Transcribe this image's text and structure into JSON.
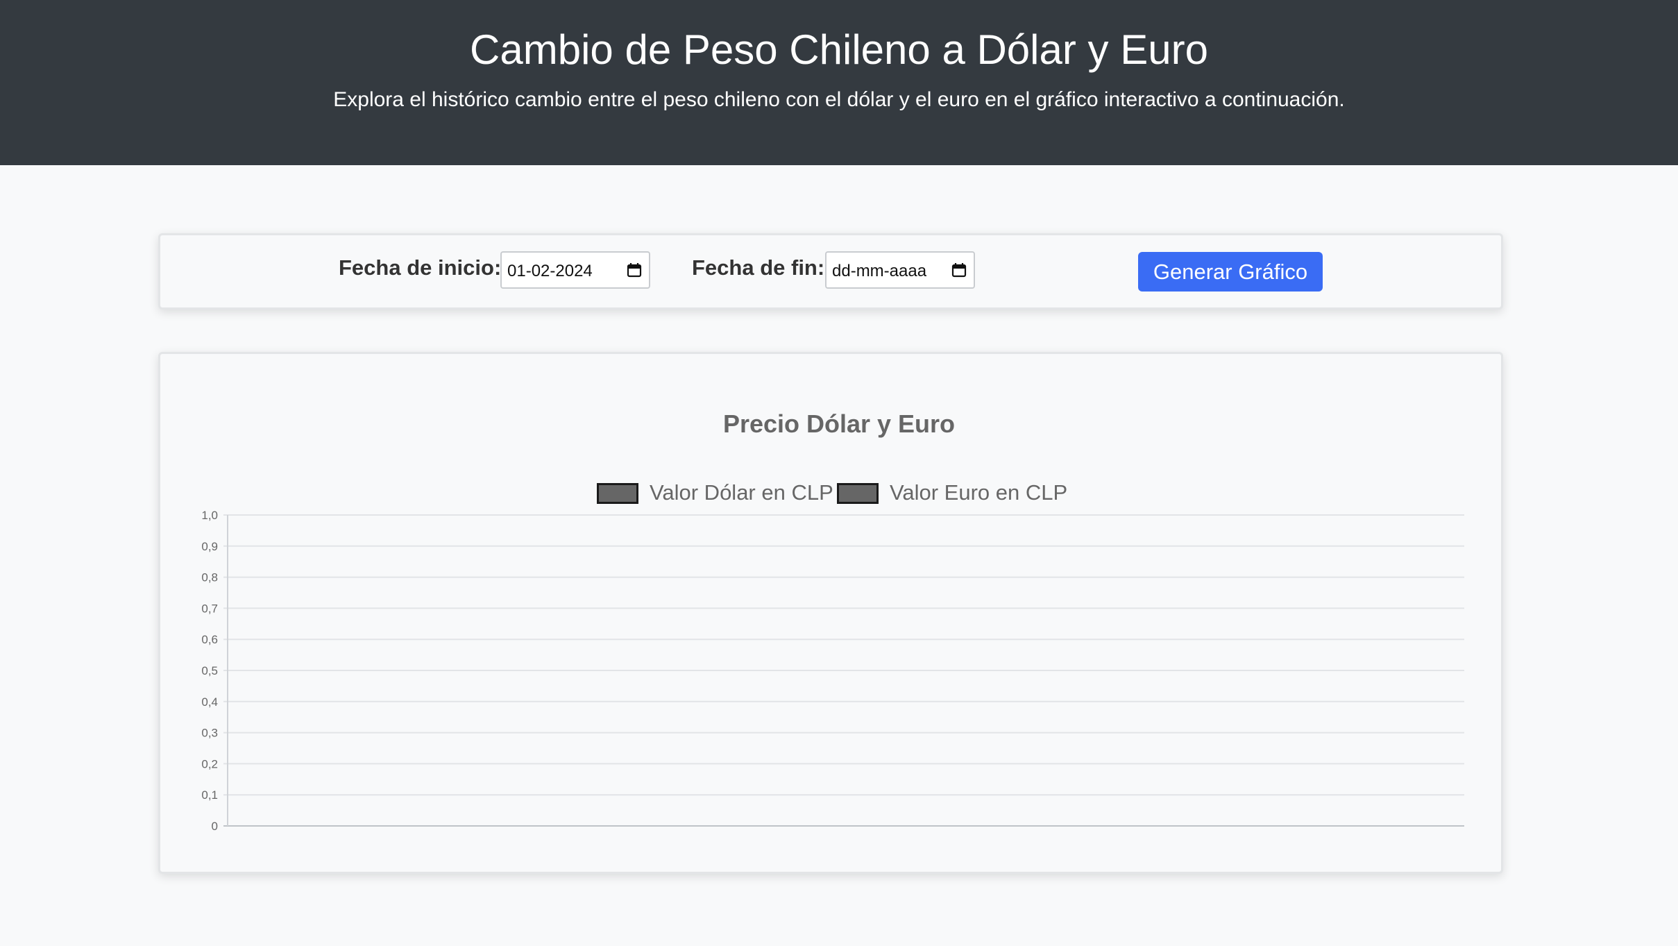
{
  "header": {
    "title": "Cambio de Peso Chileno a Dólar y Euro",
    "subtitle": "Explora el histórico cambio entre el peso chileno con el dólar y el euro en el gráfico interactivo a continuación."
  },
  "controls": {
    "start_label": "Fecha de inicio:",
    "start_value": "01-02-2024",
    "end_label": "Fecha de fin:",
    "end_value": "dd-mm-aaaa",
    "generate_label": "Generar Gráfico"
  },
  "colors": {
    "header_bg": "#343a40",
    "button_bg": "#3a6cf4",
    "legend_fill": "#666666"
  },
  "chart_data": {
    "type": "line",
    "title": "Precio Dólar y Euro",
    "xlabel": "",
    "ylabel": "",
    "ylim": [
      0,
      1
    ],
    "yticks": [
      "0",
      "0,1",
      "0,2",
      "0,3",
      "0,4",
      "0,5",
      "0,6",
      "0,7",
      "0,8",
      "0,9",
      "1,0"
    ],
    "grid": true,
    "legend_position": "top",
    "categories": [],
    "series": [
      {
        "name": "Valor Dólar en CLP",
        "values": []
      },
      {
        "name": "Valor Euro en CLP",
        "values": []
      }
    ]
  }
}
